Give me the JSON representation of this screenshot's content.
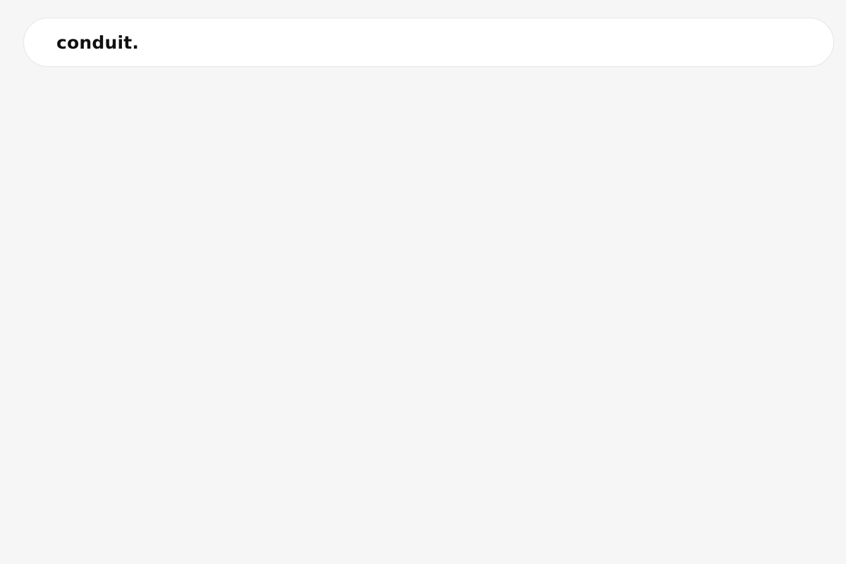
{
  "navbar": {
    "brand": "conduit."
  },
  "colors": {
    "page_background": "#f6f6f6",
    "navbar_background": "#ffffff",
    "navbar_border": "#e6e6e6",
    "brand_text": "#111111"
  }
}
